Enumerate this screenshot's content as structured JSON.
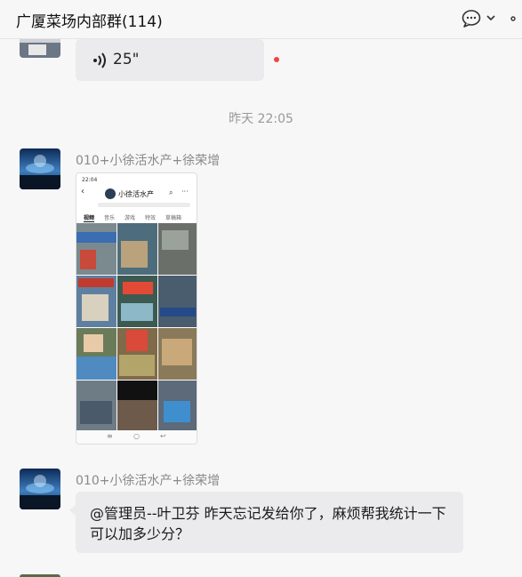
{
  "header": {
    "title": "广厦菜场内部群(114)",
    "icons": [
      "chat-bubble-icon",
      "chevron-down-icon",
      "more-icon"
    ]
  },
  "messages": {
    "voice": {
      "duration": "25\"",
      "unread": true,
      "unread_color": "#f04444"
    },
    "timestamp": "昨天 22:05",
    "image_message": {
      "sender": "010+小徐活水产+徐荣增",
      "status_bar": "22:04",
      "account_name": "小徐活水产",
      "tabs": [
        "视频",
        "音乐",
        "游戏",
        "特效",
        "草稿箱"
      ]
    },
    "text_message": {
      "sender": "010+小徐活水产+徐荣增",
      "text": "@管理员--叶卫芬 昨天忘记发给你了，麻烦帮我统计一下可以加多少分？"
    }
  },
  "colors": {
    "bubble": "#ebebed",
    "background": "#f7f7f7",
    "sender_text": "#8a8a8a"
  }
}
